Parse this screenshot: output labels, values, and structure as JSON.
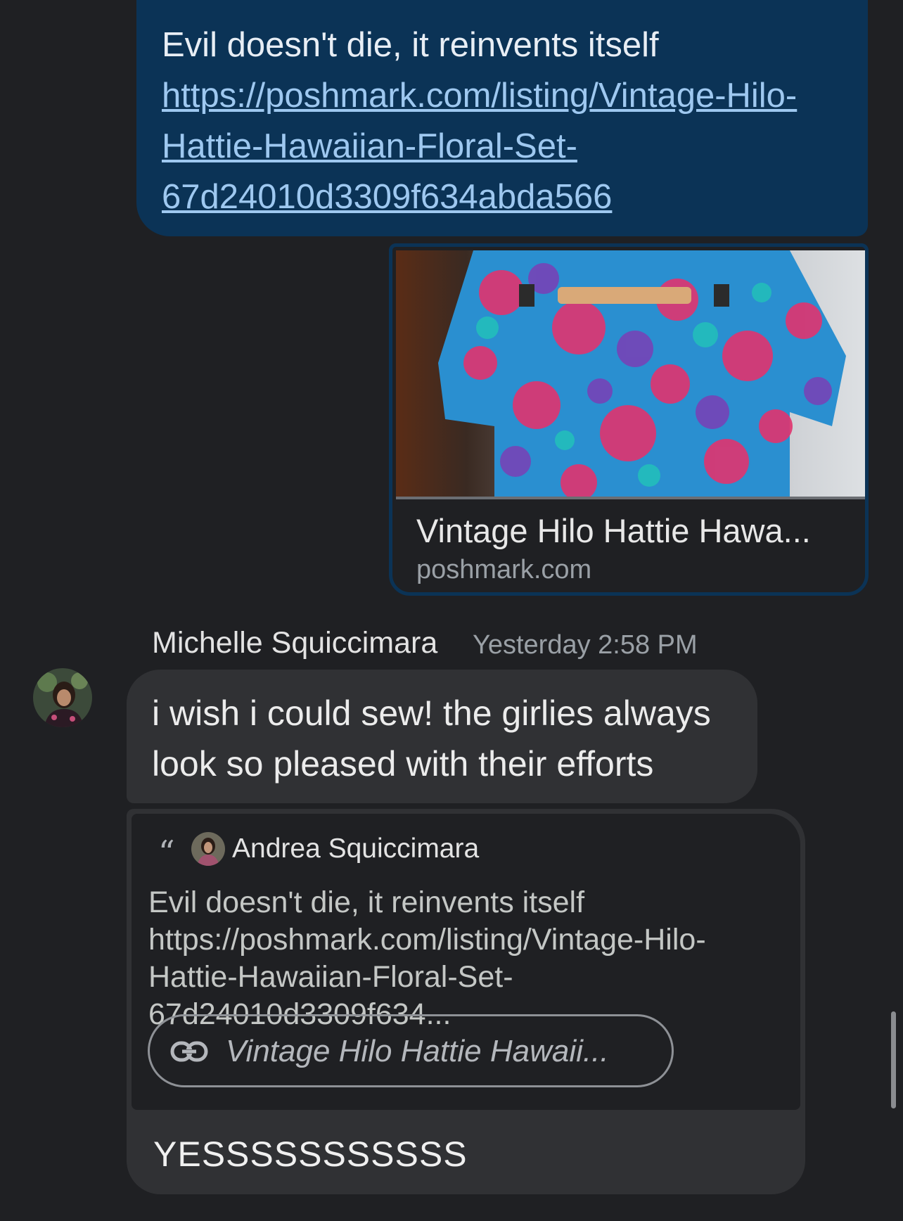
{
  "sent_message": {
    "text": "Evil doesn't die, it reinvents itself ",
    "link": "https://poshmark.com/listing/Vintage-Hilo-Hattie-Hawaiian-Floral-Set-67d24010d3309f634abda566"
  },
  "link_preview": {
    "title": "Vintage Hilo Hattie Hawa...",
    "domain": "poshmark.com"
  },
  "received": {
    "sender": "Michelle Squiccimara",
    "timestamp": "Yesterday 2:58 PM",
    "text": "i wish i could sew! the girlies always look so pleased with their efforts"
  },
  "reply": {
    "quote_mark": "“",
    "quoted_author": "Andrea Squiccimara",
    "quoted_text": "Evil doesn't die, it reinvents itself  https://poshmark.com/listing/Vintage-Hilo-Hattie-Hawaiian-Floral-Set-67d24010d3309f634...",
    "link_chip_label": "Vintage Hilo Hattie Hawaii...",
    "link_chip_icon": "link-icon",
    "text": "YESSSSSSSSSSS"
  },
  "colors": {
    "background": "#1f2023",
    "sent_bubble": "#0b3356",
    "received_bubble": "#303134",
    "link": "#9ec8f0",
    "secondary_text": "#9aa0a6"
  }
}
